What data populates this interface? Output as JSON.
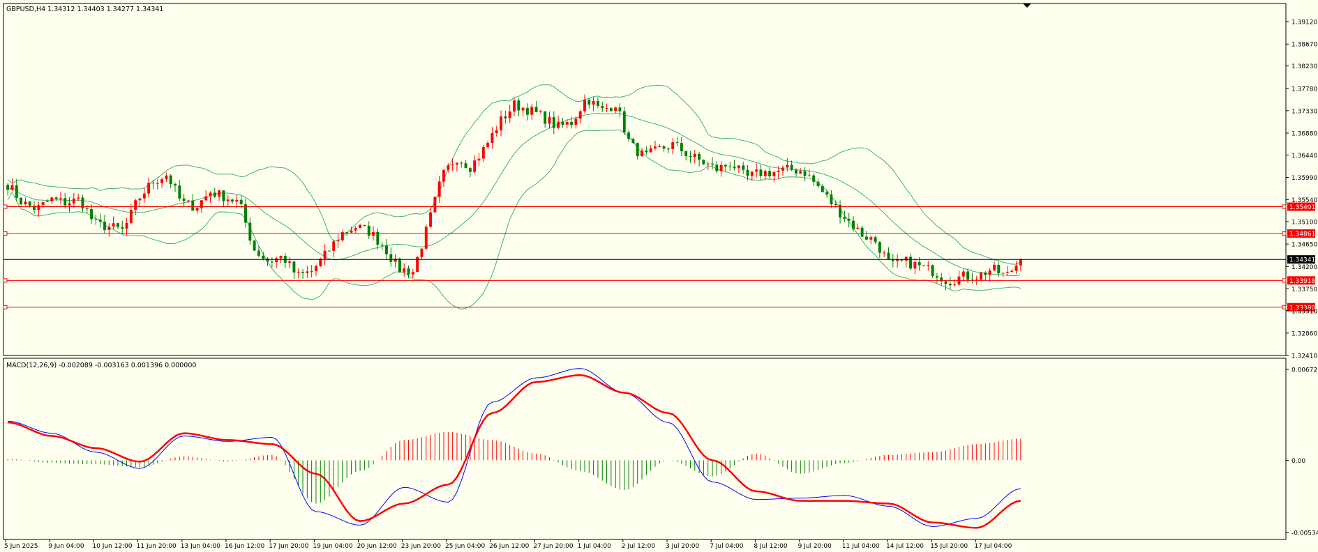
{
  "chart_data": [
    {
      "type": "candlestick",
      "title": "GBPUSD,H4  1.34312 1.34403 1.34277 1.34341",
      "ylim": [
        1.3241,
        1.3936
      ],
      "y_ticks": [
        "1.39120",
        "1.38670",
        "1.38230",
        "1.37780",
        "1.37330",
        "1.36880",
        "1.36440",
        "1.35990",
        "1.35540",
        "1.35100",
        "1.34650",
        "1.34200",
        "1.33750",
        "1.33310",
        "1.32860",
        "1.32410"
      ],
      "horizontal_levels": [
        {
          "label": "1.35401",
          "value": 1.35401,
          "color": "#FF0000"
        },
        {
          "label": "1.34861",
          "value": 1.34861,
          "color": "#FF0000"
        },
        {
          "label": "1.33918",
          "value": 1.33918,
          "color": "#FF0000"
        },
        {
          "label": "1.33380",
          "value": 1.3338,
          "color": "#FF0000"
        }
      ],
      "current_price": {
        "label": "1.34341",
        "value": 1.34341
      },
      "indicator": "Bollinger Bands",
      "x_labels": [
        "5 Jun 2025",
        "9 Jun 04:00",
        "10 Jun 12:00",
        "11 Jun 20:00",
        "13 Jun 04:00",
        "16 Jun 12:00",
        "17 Jun 20:00",
        "19 Jun 04:00",
        "20 Jun 12:00",
        "23 Jun 20:00",
        "25 Jun 04:00",
        "26 Jun 12:00",
        "27 Jun 20:00",
        "1 Jul 04:00",
        "2 Jul 12:00",
        "3 Jul 20:00",
        "7 Jul 04:00",
        "8 Jul 12:00",
        "9 Jul 20:00",
        "11 Jul 04:00",
        "14 Jul 12:00",
        "15 Jul 20:00",
        "17 Jul 04:00"
      ],
      "close_path": [
        1.3585,
        1.3548,
        1.3535,
        1.3555,
        1.3548,
        1.3555,
        1.3505,
        1.35,
        1.3492,
        1.3555,
        1.359,
        1.3605,
        1.3548,
        1.354,
        1.357,
        1.356,
        1.3548,
        1.3455,
        1.343,
        1.344,
        1.34,
        1.341,
        1.3445,
        1.3485,
        1.35,
        1.349,
        1.346,
        1.3415,
        1.341,
        1.3498,
        1.36,
        1.364,
        1.362,
        1.366,
        1.371,
        1.3745,
        1.3735,
        1.372,
        1.37,
        1.371,
        1.376,
        1.3732,
        1.3748,
        1.3665,
        1.364,
        1.3655,
        1.3665,
        1.3645,
        1.363,
        1.3615,
        1.3628,
        1.3598,
        1.3608,
        1.361,
        1.3615,
        1.3612,
        1.358,
        1.3545,
        1.3515,
        1.3485,
        1.347,
        1.342,
        1.343,
        1.342,
        1.341,
        1.339,
        1.34,
        1.34,
        1.3415,
        1.34,
        1.3434
      ]
    },
    {
      "type": "line",
      "title": "MACD(12,26,9) -0.002089 -0.003163 0.001396 0.000000",
      "ylim": [
        -0.005342,
        0.006727
      ],
      "y_ticks": [
        "0.006727",
        "0.00",
        "-0.005342"
      ],
      "series": [
        {
          "color": "#0000FF",
          "values": [
            0.0029,
            0.002,
            0.0006,
            -0.0006,
            0.0018,
            0.0014,
            0.0017,
            -0.0038,
            -0.0048,
            -0.002,
            -0.0031,
            0.0043,
            0.0061,
            0.0068,
            0.005,
            0.0028,
            -0.0016,
            -0.0029,
            -0.0028,
            -0.0026,
            -0.0034,
            -0.0049,
            -0.0043,
            -0.0021
          ]
        },
        {
          "color": "#FF0000",
          "values": [
            0.0028,
            0.0018,
            0.0009,
            -0.0001,
            0.002,
            0.0015,
            0.0012,
            -0.001,
            -0.0045,
            -0.0032,
            -0.0018,
            0.0035,
            0.0058,
            0.0063,
            0.005,
            0.0035,
            0.0,
            -0.0023,
            -0.003,
            -0.003,
            -0.0032,
            -0.0046,
            -0.005,
            -0.003
          ]
        }
      ],
      "histogram": [
        0.0001,
        -0.0002,
        -0.0003,
        -0.0005,
        0.0003,
        -0.0001,
        0.0004,
        -0.0032,
        -0.0008,
        0.0015,
        0.0021,
        0.0015,
        0.0005,
        -0.0008,
        -0.0022,
        0.0,
        -0.0012,
        0.0005,
        -0.001,
        -0.0002,
        0.0004,
        0.0006,
        0.0012,
        0.0016
      ]
    }
  ]
}
